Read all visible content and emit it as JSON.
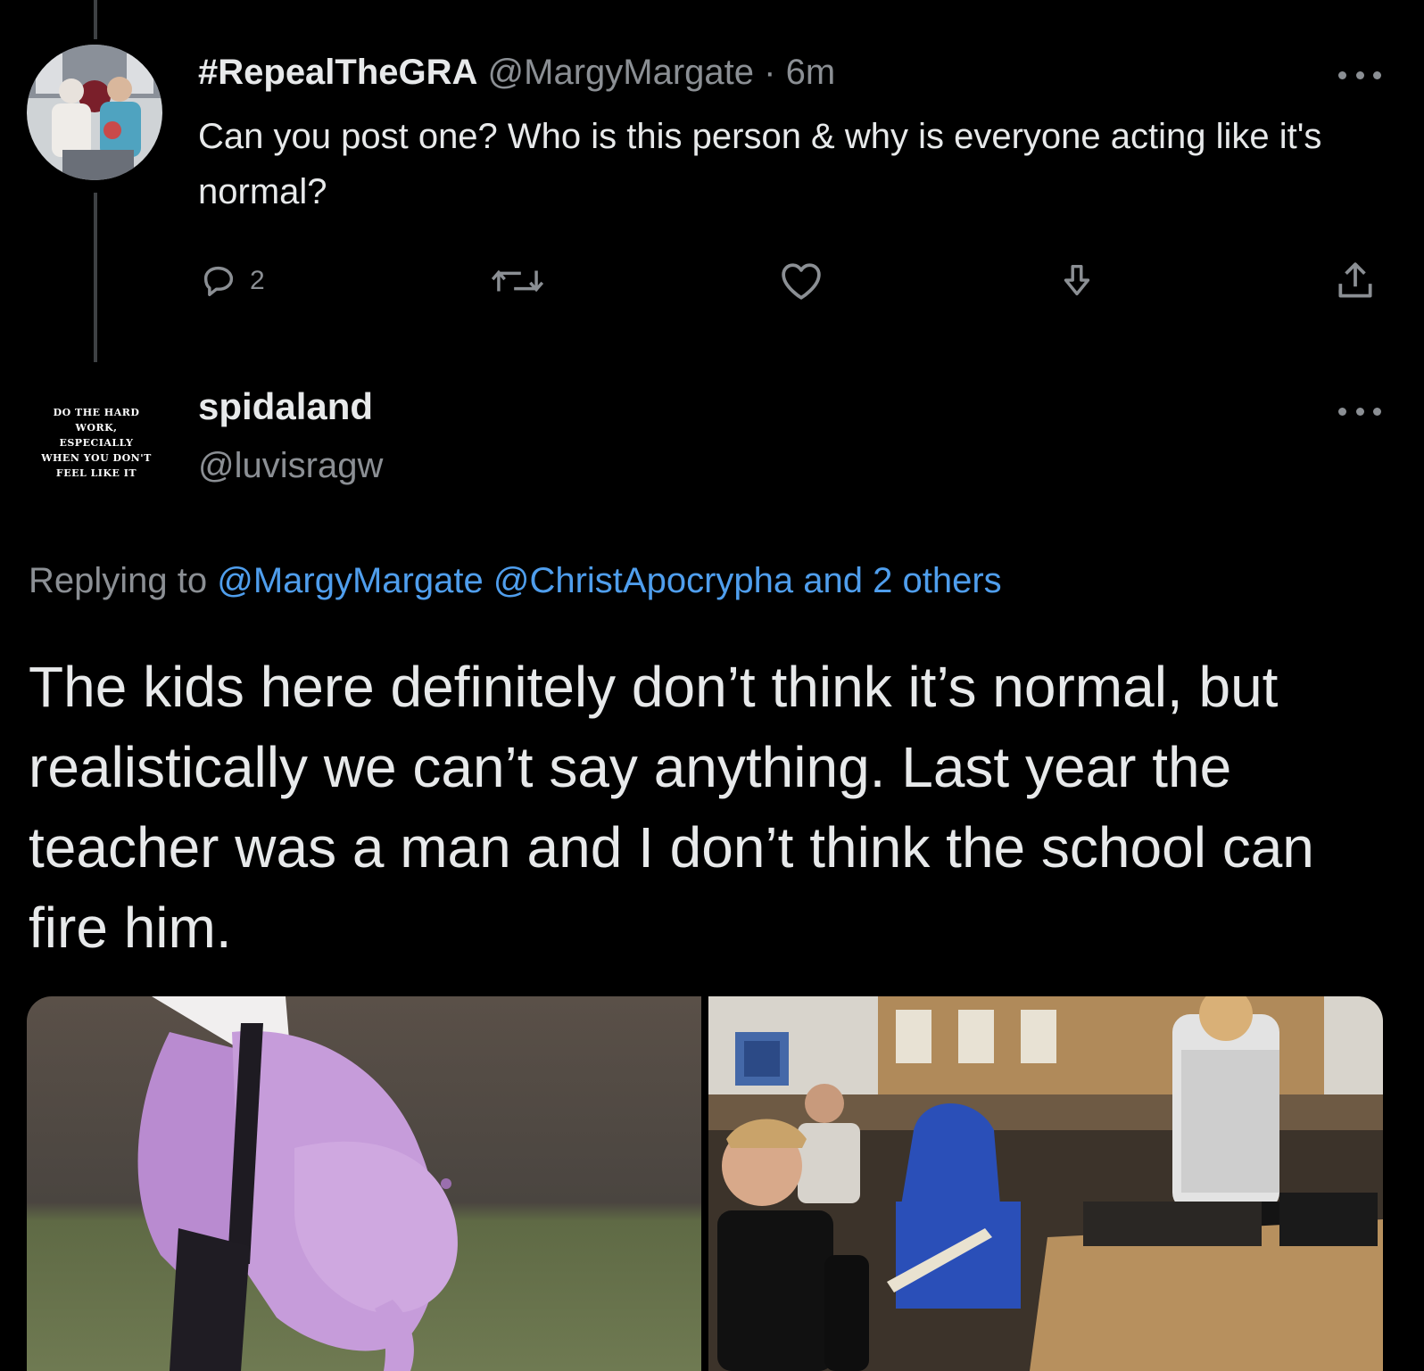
{
  "tweet1": {
    "display_name": "#RepealTheGRA",
    "handle": "@MargyMargate",
    "separator": " · ",
    "time": "6m",
    "text": "Can you post one? Who is this person & why is everyone acting like it's normal?",
    "actions": {
      "reply_count": "2",
      "icons": [
        "reply-icon",
        "retweet-icon",
        "like-icon",
        "download-icon",
        "share-icon"
      ]
    }
  },
  "tweet2": {
    "display_name": "spidaland",
    "handle": "@luvisragw",
    "avatar_text": "DO THE HARD WORK, ESPECIALLY WHEN YOU DON'T FEEL LIKE IT",
    "replying_prefix": "Replying to ",
    "replying_mention1": "@MargyMargate",
    "replying_mention2": "@ChristApocrypha",
    "replying_others": "and 2 others",
    "text": "The kids here definitely don’t think it’s normal, but realistically we can’t say anything. Last year the teacher was a man and I don’t think the school can fire him."
  },
  "colors": {
    "background": "#000000",
    "text": "#e7e9ea",
    "muted": "#8b8f94",
    "link": "#4f9eed",
    "thread_line": "#3e4144"
  }
}
